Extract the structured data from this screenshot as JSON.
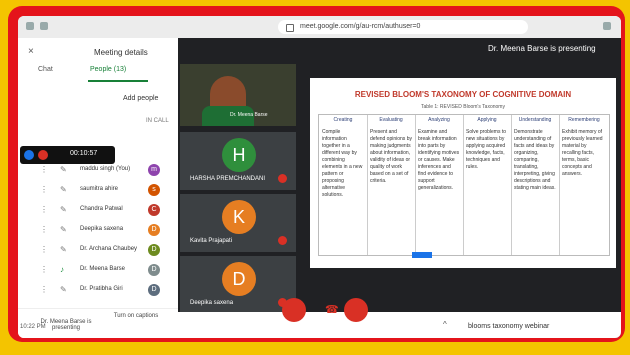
{
  "browser": {
    "url": "meet.google.com/g/au-rcm/authuser=0"
  },
  "panel": {
    "title": "Meeting details",
    "close": "×",
    "tabs": [
      {
        "label": "People (13)"
      },
      {
        "label": "Chat"
      }
    ],
    "add_people": "Add people",
    "in_call": "IN CALL",
    "participants": [
      {
        "name": "maddu singh (You)",
        "initial": "m",
        "color": "#8e44ad"
      },
      {
        "name": "saumitra ahire",
        "initial": "s",
        "color": "#d35400"
      },
      {
        "name": "Chandra Patwal",
        "initial": "C",
        "color": "#c0392b"
      },
      {
        "name": "Deepika saxena",
        "initial": "D",
        "color": "#e67e22"
      },
      {
        "name": "Dr. Archana Chaubey",
        "initial": "D",
        "color": "#6d8b1f"
      },
      {
        "name": "Dr. Meena Barse",
        "initial": "D",
        "color": "#7f8c8d"
      },
      {
        "name": "Dr. Pratibha Giri",
        "initial": "D",
        "color": "#5d6d7e"
      }
    ],
    "recording_time": "00:10:57",
    "bottom": {
      "captions": "Turn on captions",
      "presenting": "Dr. Meena Barse is presenting"
    },
    "clock": "10:22 PM"
  },
  "stage": {
    "presenting": "Dr. Meena Barse is presenting",
    "camera_label": "Dr. Meena Barse",
    "tiles": [
      {
        "name": "HARSHA PREMCHANDANI",
        "initial": "H",
        "color": "#2f8f3c"
      },
      {
        "name": "Kavita Prajapati",
        "initial": "K",
        "color": "#e67e22"
      },
      {
        "name": "Deepika saxena",
        "initial": "D",
        "color": "#e67e22"
      }
    ]
  },
  "slide": {
    "title": "REVISED BLOOM'S TAXONOMY OF COGNITIVE DOMAIN",
    "subtitle": "Table 1: REVISED Bloom's Taxonomy",
    "columns": [
      {
        "head": "Remembering",
        "body": "Exhibit memory of previously learned material by recalling facts, terms, basic concepts and answers."
      },
      {
        "head": "Understanding",
        "body": "Demonstrate understanding of facts and ideas by organizing, comparing, translating, interpreting, giving descriptions and stating main ideas."
      },
      {
        "head": "Applying",
        "body": "Solve problems to new situations by applying acquired knowledge, facts, techniques and rules."
      },
      {
        "head": "Analyzing",
        "body": "Examine and break information into parts by identifying motives or causes. Make inferences and find evidence to support generalizations."
      },
      {
        "head": "Evaluating",
        "body": "Present and defend opinions by making judgments about information, validity of ideas or quality of work based on a set of criteria."
      },
      {
        "head": "Creating",
        "body": "Compile information together in a different way by combining elements in a new pattern or proposing alternative solutions."
      }
    ]
  },
  "footer": {
    "meeting_name": "blooms taxonomy webinar",
    "caret": "^"
  }
}
